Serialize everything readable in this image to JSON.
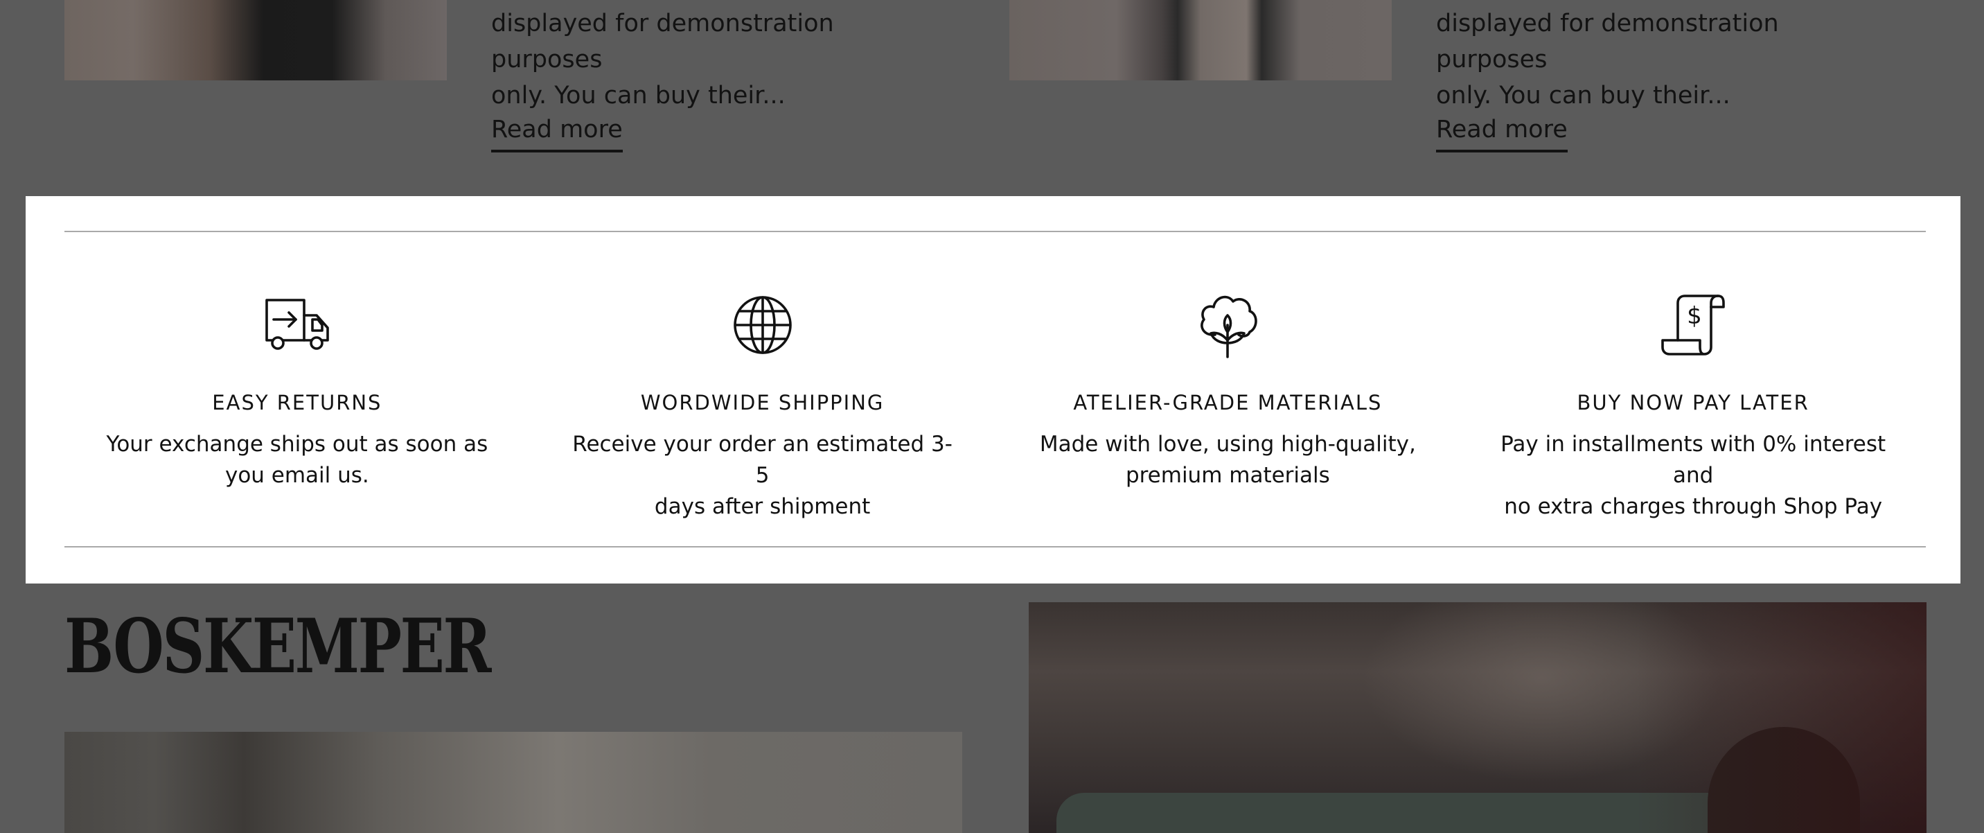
{
  "blog": {
    "posts": [
      {
        "excerpt_line1": "displayed for demonstration purposes",
        "excerpt_line2": "only. You can buy their...",
        "read_more": "Read more"
      },
      {
        "excerpt_line1": "displayed for demonstration purposes",
        "excerpt_line2": "only. You can buy their...",
        "read_more": "Read more"
      }
    ]
  },
  "features": [
    {
      "icon": "delivery-truck-icon",
      "title": "EASY RETURNS",
      "desc_line1": "Your exchange ships out as soon as",
      "desc_line2": "you email us."
    },
    {
      "icon": "globe-icon",
      "title": "WORDWIDE SHIPPING",
      "desc_line1": "Receive your order an estimated 3-5",
      "desc_line2": "days after shipment"
    },
    {
      "icon": "cotton-flower-icon",
      "title": "ATELIER-GRADE MATERIALS",
      "desc_line1": "Made with love, using high-quality,",
      "desc_line2": "premium materials"
    },
    {
      "icon": "receipt-dollar-icon",
      "title": "BUY NOW PAY LATER",
      "desc_line1": "Pay in installments with 0% interest and",
      "desc_line2": "no extra charges through Shop Pay"
    }
  ],
  "brand": {
    "name": "BOSKEMPER"
  },
  "colors": {
    "overlay": "#5b5b5b",
    "band_background": "#ffffff",
    "text": "#121212",
    "rule": "#a9a9a9"
  }
}
